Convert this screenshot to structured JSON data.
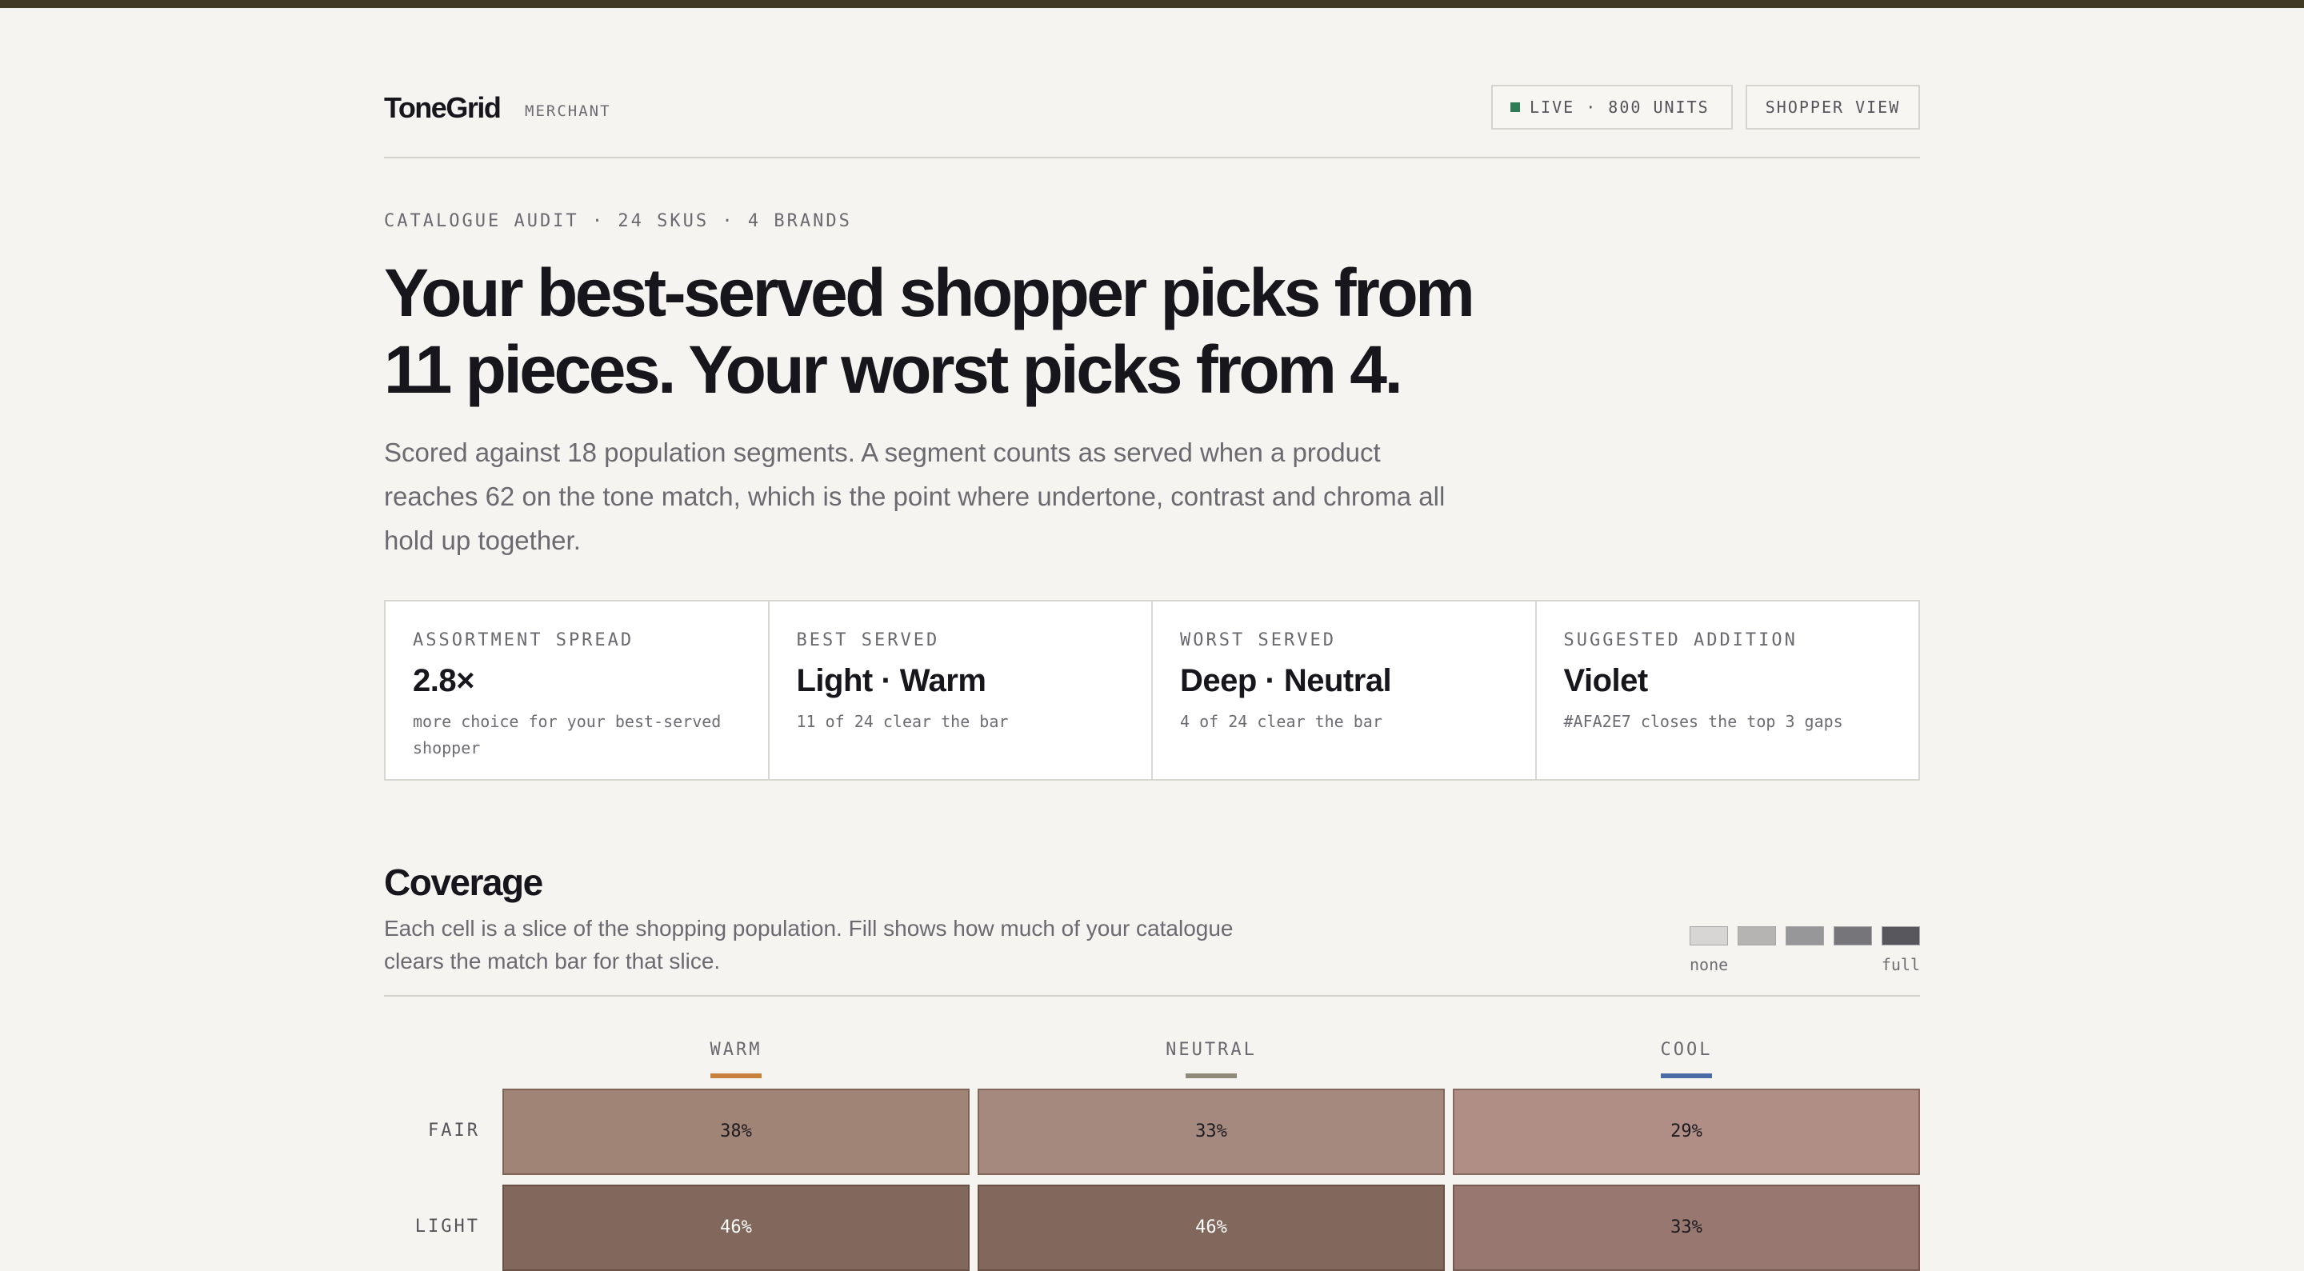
{
  "header": {
    "brand": "ToneGrid",
    "role": "MERCHANT",
    "live_label": "LIVE · 800 UNITS",
    "live_color": "#2f7a57",
    "shopper_view_label": "SHOPPER VIEW"
  },
  "hero": {
    "eyebrow": "CATALOGUE AUDIT · 24 SKUS · 4 BRANDS",
    "headline_line1": "Your best-served shopper picks from",
    "headline_line2": "11 pieces. Your worst picks from 4.",
    "lede": "Scored against 18 population segments. A segment counts as served when a product reaches 62 on the tone match, which is the point where undertone, contrast and chroma all hold up together."
  },
  "stats": [
    {
      "label": "ASSORTMENT SPREAD",
      "value": "2.8×",
      "sub": "more choice for your best-served shopper"
    },
    {
      "label": "BEST SERVED",
      "value": "Light · Warm",
      "sub": "11 of 24 clear the bar"
    },
    {
      "label": "WORST SERVED",
      "value": "Deep · Neutral",
      "sub": "4 of 24 clear the bar"
    },
    {
      "label": "SUGGESTED ADDITION",
      "value": "Violet",
      "sub": "#AFA2E7 closes the top 3 gaps"
    }
  ],
  "coverage": {
    "title": "Coverage",
    "description": "Each cell is a slice of the shopping population. Fill shows how much of your catalogue clears the match bar for that slice.",
    "legend": {
      "low_label": "none",
      "high_label": "full",
      "swatches": [
        "#d6d5d3",
        "#b5b4b2",
        "#979698",
        "#76757a",
        "#57565c"
      ]
    },
    "columns": [
      {
        "label": "WARM",
        "color": "#c9813d"
      },
      {
        "label": "NEUTRAL",
        "color": "#8f8b78"
      },
      {
        "label": "COOL",
        "color": "#4a6aa6"
      }
    ],
    "rows": [
      {
        "label": "FAIR",
        "cells": [
          {
            "text": "38%",
            "fill": "#a08475",
            "ink": "#1c1b22"
          },
          {
            "text": "33%",
            "fill": "#a6897e",
            "ink": "#1c1b22"
          },
          {
            "text": "29%",
            "fill": "#b08e85",
            "ink": "#1c1b22"
          }
        ]
      },
      {
        "label": "LIGHT",
        "cells": [
          {
            "text": "46%",
            "fill": "#82685c",
            "ink": "#ffffff"
          },
          {
            "text": "46%",
            "fill": "#82685c",
            "ink": "#ffffff"
          },
          {
            "text": "33%",
            "fill": "#977770",
            "ink": "#1c1b22"
          }
        ]
      }
    ]
  }
}
